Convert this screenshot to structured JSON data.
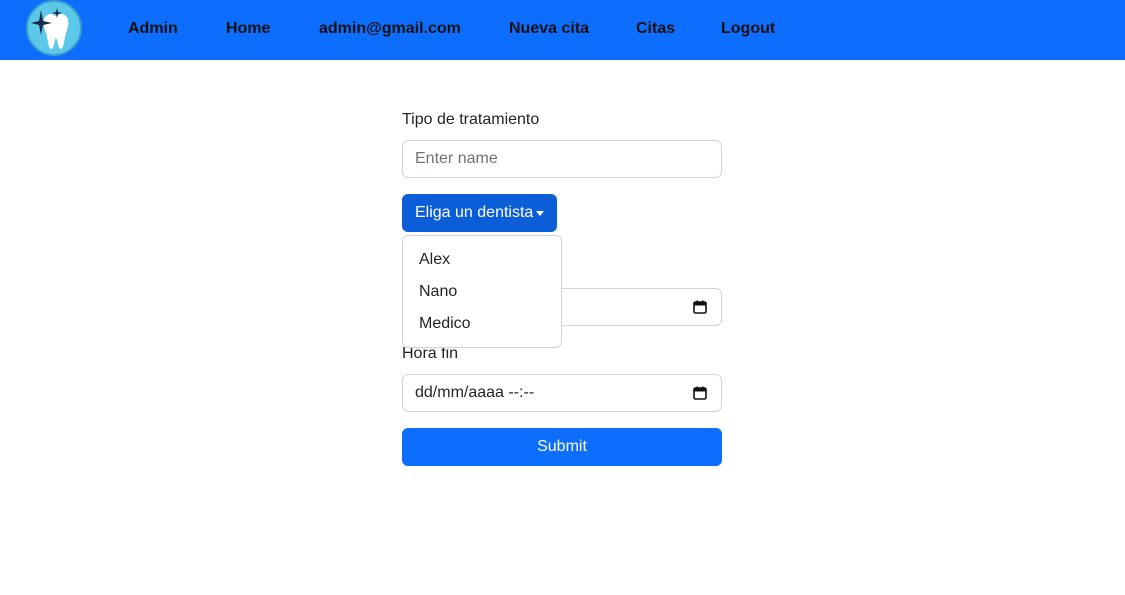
{
  "navbar": {
    "brand_color": "#0d6efd",
    "logo": "tooth-logo",
    "links": [
      "Admin",
      "Home",
      "admin@gmail.com",
      "Nueva cita",
      "Citas",
      "Logout"
    ]
  },
  "form": {
    "treatment_label": "Tipo de tratamiento",
    "treatment_placeholder": "Enter name",
    "treatment_value": "",
    "dentist_dropdown_label": "Eliga un dentista",
    "dentist_options": [
      "Alex",
      "Nano",
      "Medico"
    ],
    "start_value": "",
    "end_label": "Hora fin",
    "end_value": "dd/mm/aaaa --:--",
    "submit_label": "Submit"
  }
}
